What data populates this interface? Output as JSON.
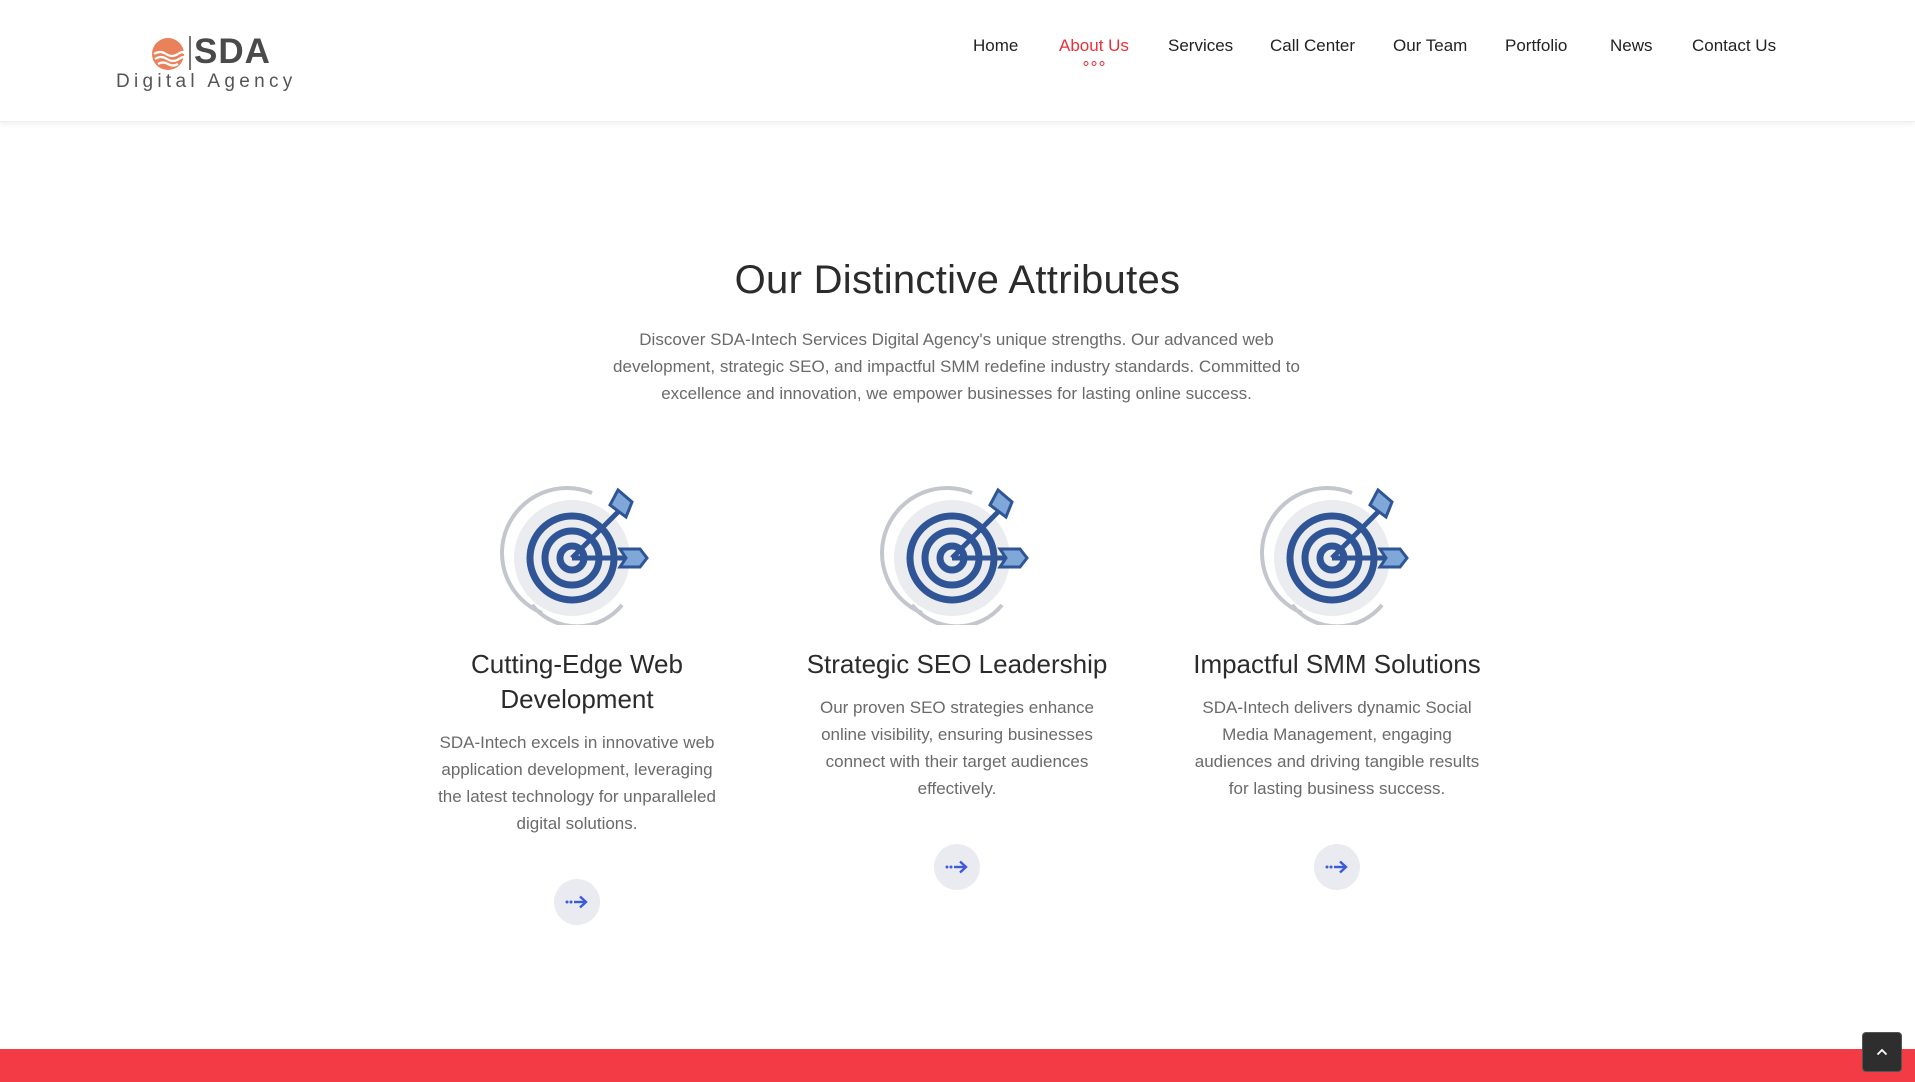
{
  "header": {
    "brand": "SDA",
    "tagline": "Digital Agency",
    "nav": [
      {
        "label": "Home",
        "active": false
      },
      {
        "label": "About Us",
        "active": true
      },
      {
        "label": "Services",
        "active": false
      },
      {
        "label": "Call Center",
        "active": false
      },
      {
        "label": "Our Team",
        "active": false
      },
      {
        "label": "Portfolio",
        "active": false
      },
      {
        "label": "News",
        "active": false
      },
      {
        "label": "Contact Us",
        "active": false
      }
    ]
  },
  "section": {
    "title": "Our Distinctive Attributes",
    "description": "Discover SDA-Intech Services Digital Agency's unique strengths. Our advanced web development, strategic SEO, and impactful SMM redefine industry standards. Committed to excellence and innovation, we empower businesses for lasting online success."
  },
  "cards": [
    {
      "title": "Cutting-Edge Web Development",
      "text": "SDA-Intech excels in innovative web application development, leveraging the latest technology for unparalleled digital solutions.",
      "icon": "target-arrow-icon"
    },
    {
      "title": "Strategic SEO Leadership",
      "text": "Our proven SEO strategies enhance online visibility, ensuring businesses connect with their target audiences effectively.",
      "icon": "target-arrow-icon"
    },
    {
      "title": "Impactful SMM Solutions",
      "text": "SDA-Intech delivers dynamic Social Media Management, engaging audiences and driving tangible results for lasting business success.",
      "icon": "target-arrow-icon"
    }
  ],
  "colors": {
    "accent": "#e8313a",
    "footer": "#f23b45",
    "icon_primary": "#2f5597",
    "icon_light": "#7fa8d8",
    "arrow_button": "#3b5bdb"
  },
  "icons": {
    "logo": "sun-waves-icon",
    "card_button": "dotted-arrow-right-icon",
    "scroll_top": "chevron-up-icon"
  }
}
